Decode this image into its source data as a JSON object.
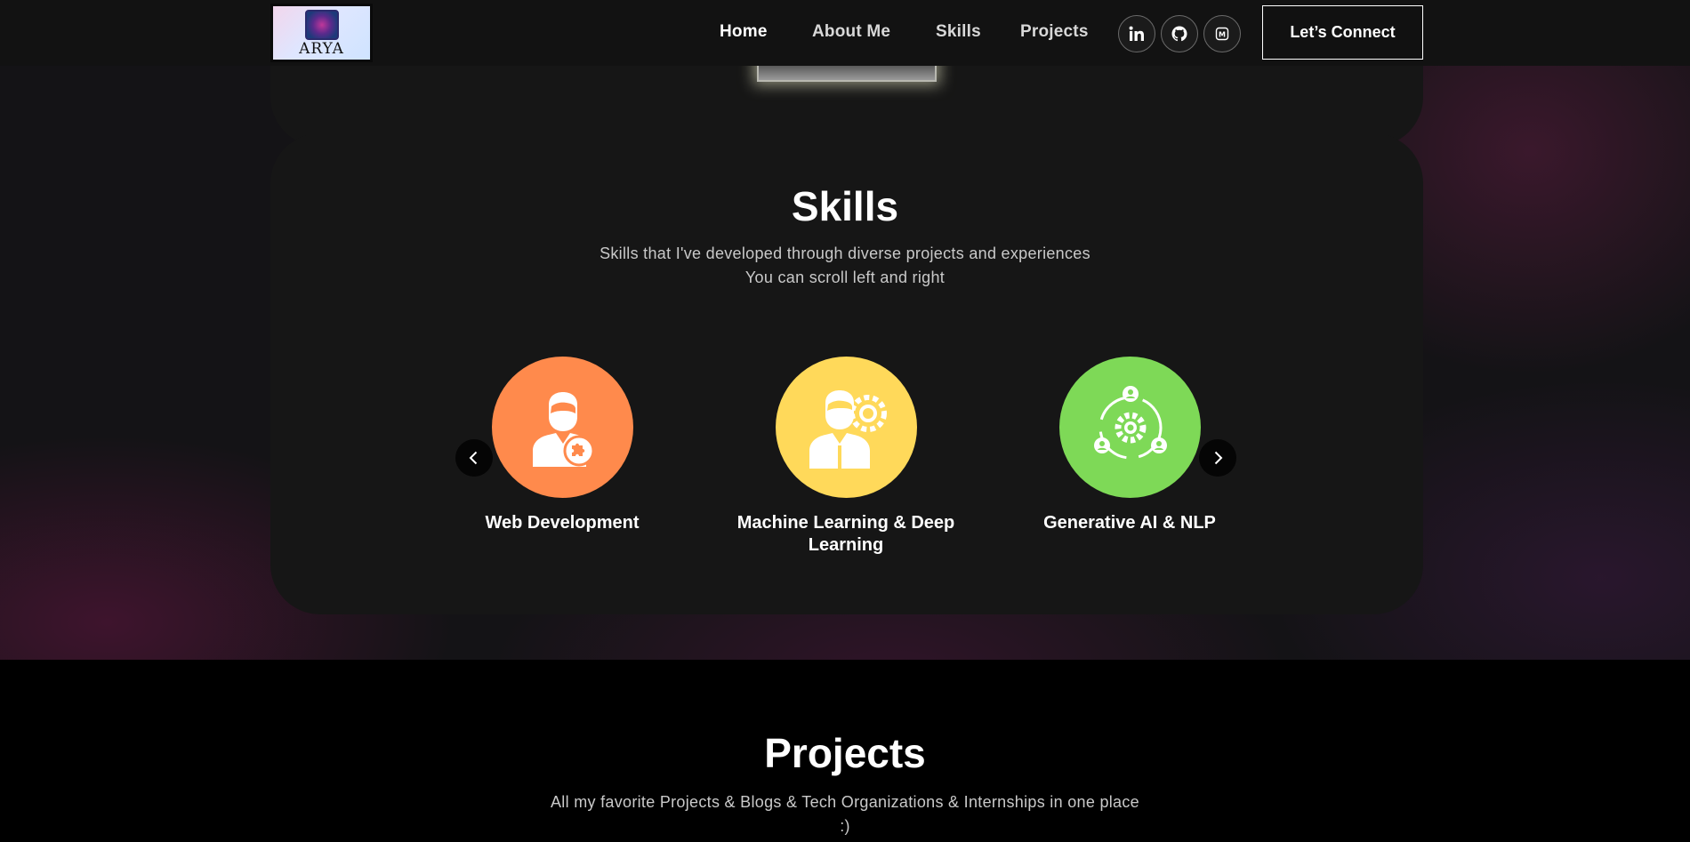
{
  "nav": {
    "logo_text": "ARYA",
    "links": [
      "Home",
      "About Me",
      "Skills",
      "Projects"
    ],
    "active": "Home",
    "connect_label": "Let’s Connect",
    "socials": [
      "linkedin-icon",
      "github-icon",
      "medium-icon"
    ]
  },
  "skills": {
    "title": "Skills",
    "subtitle_line1": "Skills that I've developed through diverse projects and experiences",
    "subtitle_line2": "You can scroll left and right",
    "items": [
      {
        "label": "Web Development",
        "color": "#ff8a4c",
        "icon": "developer-puzzle-icon"
      },
      {
        "label": "Machine Learning & Deep Learning",
        "color": "#ffd95a",
        "icon": "person-gear-icon"
      },
      {
        "label": "Generative AI & NLP",
        "color": "#7ed957",
        "icon": "network-gear-icon"
      }
    ]
  },
  "projects": {
    "title": "Projects",
    "subtitle_line1": "All my favorite Projects & Blogs & Tech Organizations & Internships in one place",
    "subtitle_line2": ":)"
  }
}
